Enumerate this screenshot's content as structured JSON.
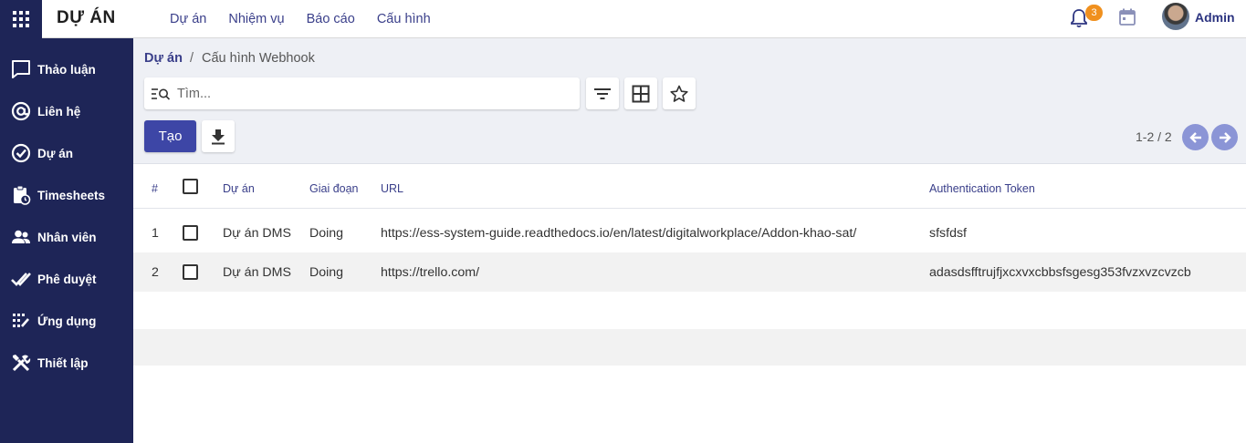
{
  "app": {
    "title": "DỰ ÁN"
  },
  "topnav": [
    "Dự án",
    "Nhiệm vụ",
    "Báo cáo",
    "Cấu hình"
  ],
  "user": {
    "notifications": "3",
    "name": "Admin"
  },
  "sidebar": {
    "items": [
      {
        "label": "Thảo luận",
        "icon": "chat-icon"
      },
      {
        "label": "Liên hệ",
        "icon": "at-icon"
      },
      {
        "label": "Dự án",
        "icon": "check-circle-icon"
      },
      {
        "label": "Timesheets",
        "icon": "clipboard-clock-icon"
      },
      {
        "label": "Nhân viên",
        "icon": "people-icon"
      },
      {
        "label": "Phê duyệt",
        "icon": "double-check-icon"
      },
      {
        "label": "Ứng dụng",
        "icon": "apps-list-icon"
      },
      {
        "label": "Thiết lập",
        "icon": "tools-icon"
      }
    ]
  },
  "breadcrumb": {
    "parent": "Dự án",
    "separator": "/",
    "current": "Cấu hình Webhook"
  },
  "search": {
    "placeholder": "Tìm...",
    "value": ""
  },
  "toolbar": {
    "create_label": "Tạo"
  },
  "pager": {
    "text": "1-2 / 2"
  },
  "table": {
    "columns": [
      "#",
      "Dự án",
      "Giai đoạn",
      "URL",
      "Authentication Token"
    ],
    "rows": [
      {
        "num": "1",
        "project": "Dự án DMS",
        "stage": "Doing",
        "url": "https://ess-system-guide.readthedocs.io/en/latest/digitalworkplace/Addon-khao-sat/",
        "token": "sfsfdsf"
      },
      {
        "num": "2",
        "project": "Dự án DMS",
        "stage": "Doing",
        "url": "https://trello.com/",
        "token": "adasdsfftrujfjxcxvxcbbsfsgesg353fvzxvzcvzcb"
      }
    ]
  },
  "colors": {
    "sidebar_bg": "#1e2557",
    "accent": "#3d46a6",
    "link": "#3a3f8a",
    "badge": "#f0901e"
  }
}
